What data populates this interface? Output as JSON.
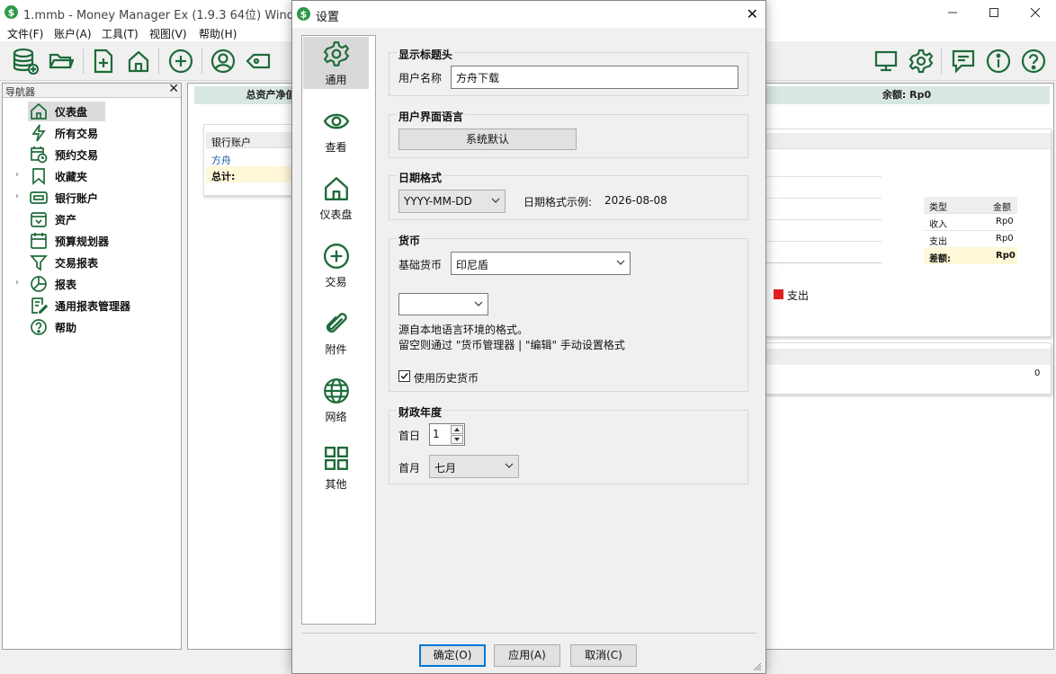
{
  "main_window": {
    "title": "1.mmb - Money Manager Ex (1.9.3 64位) Windows",
    "menu": [
      "文件(F)",
      "账户(A)",
      "工具(T)",
      "视图(V)",
      "帮助(H)"
    ]
  },
  "toolbar": {
    "icons": [
      "database-icon",
      "folder-open-icon",
      "new-transaction-icon",
      "home-icon",
      "add-icon",
      "user-icon",
      "tag-icon",
      "monitor-icon",
      "gear-icon",
      "chat-icon",
      "info-icon",
      "help-icon"
    ]
  },
  "navigator": {
    "title": "导航器",
    "items": [
      {
        "label": "仪表盘",
        "icon": "home-icon",
        "expandable": false,
        "selected": true
      },
      {
        "label": "所有交易",
        "icon": "lightning-icon",
        "expandable": false
      },
      {
        "label": "预约交易",
        "icon": "calendar-clock-icon",
        "expandable": false
      },
      {
        "label": "收藏夹",
        "icon": "bookmark-icon",
        "expandable": true
      },
      {
        "label": "银行账户",
        "icon": "bank-card-icon",
        "expandable": true
      },
      {
        "label": "资产",
        "icon": "asset-box-icon",
        "expandable": false
      },
      {
        "label": "预算规划器",
        "icon": "calendar-icon",
        "expandable": false
      },
      {
        "label": "交易报表",
        "icon": "filter-icon",
        "expandable": false
      },
      {
        "label": "报表",
        "icon": "pie-chart-icon",
        "expandable": true
      },
      {
        "label": "通用报表管理器",
        "icon": "report-edit-icon",
        "expandable": false
      },
      {
        "label": "帮助",
        "icon": "help-icon",
        "expandable": false
      }
    ]
  },
  "dashboard": {
    "net_worth_header": "总资产净值",
    "balance_header": "余额: Rp0",
    "bank_widget": {
      "title": "银行账户",
      "account": "方舟",
      "total_label": "总计:"
    },
    "summary_table": {
      "headers": [
        "类型",
        "金额"
      ],
      "rows": [
        [
          "收入",
          "Rp0"
        ],
        [
          "支出",
          "Rp0"
        ]
      ],
      "diff_label": "差额:",
      "diff_value": "Rp0"
    },
    "legend_expense": "支出",
    "lower_value": "0"
  },
  "dialog": {
    "title": "设置",
    "categories": [
      {
        "label": "通用",
        "icon": "gear-icon",
        "selected": true
      },
      {
        "label": "查看",
        "icon": "eye-icon"
      },
      {
        "label": "仪表盘",
        "icon": "home-icon"
      },
      {
        "label": "交易",
        "icon": "add-circle-icon"
      },
      {
        "label": "附件",
        "icon": "paperclip-icon"
      },
      {
        "label": "网络",
        "icon": "globe-icon"
      },
      {
        "label": "其他",
        "icon": "grid-icon"
      }
    ],
    "header_group": {
      "title": "显示标题头",
      "username_label": "用户名称",
      "username_value": "方舟下载"
    },
    "language_group": {
      "title": "用户界面语言",
      "button": "系统默认"
    },
    "date_group": {
      "title": "日期格式",
      "format_value": "YYYY-MM-DD",
      "example_label": "日期格式示例:",
      "example_value": "2026-08-08"
    },
    "currency_group": {
      "title": "货币",
      "base_label": "基础货币",
      "base_value": "印尼盾",
      "locale_value": "",
      "note_line1": "源自本地语言环境的格式。",
      "note_line2": "留空则通过 \"货币管理器 | \"编辑\" 手动设置格式",
      "history_label": "使用历史货币",
      "history_checked": true
    },
    "fiscal_group": {
      "title": "财政年度",
      "day_label": "首日",
      "day_value": "1",
      "month_label": "首月",
      "month_value": "七月"
    },
    "buttons": {
      "ok": "确定(O)",
      "apply": "应用(A)",
      "cancel": "取消(C)"
    }
  },
  "colors": {
    "accent": "#1e6b3a",
    "dashboard_header": "#d8e7e0",
    "expense_legend": "#e02020"
  }
}
